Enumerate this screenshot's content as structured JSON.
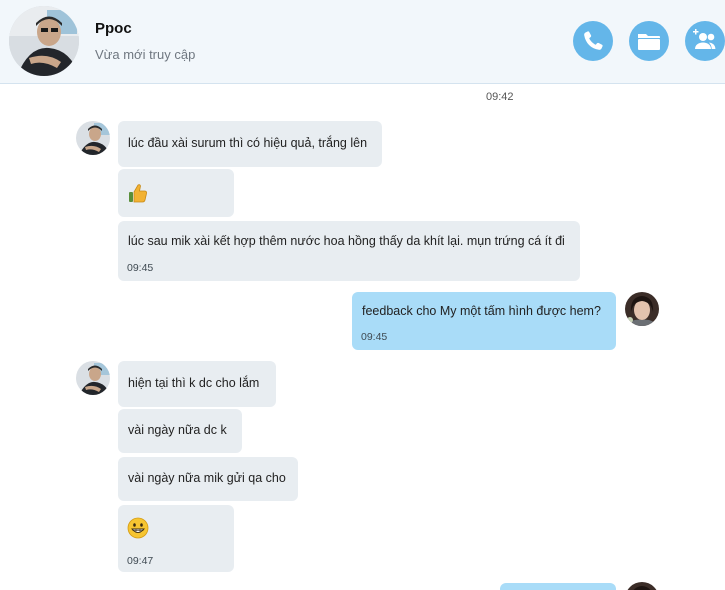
{
  "header": {
    "name": "Ppoc",
    "status": "Vừa mới truy cập",
    "icons": {
      "call": "phone-icon",
      "files": "folder-icon",
      "add": "add-user-icon"
    },
    "accent": "#64b6e9"
  },
  "chat": {
    "time_center": "09:42",
    "messages": [
      {
        "id": "m1",
        "dir": "in",
        "text": "lúc đầu xài surum thì có hiệu quả, trắng lên"
      },
      {
        "id": "m2",
        "dir": "in",
        "emoji": "thumbs-up-icon"
      },
      {
        "id": "m3",
        "dir": "in",
        "text": "lúc sau mik xài kết hợp thêm nước hoa hồng thấy da khít lại. mụn trứng cá ít đi",
        "time": "09:45"
      },
      {
        "id": "m4",
        "dir": "out",
        "text": "feedback cho My một tấm hình được hem?",
        "time": "09:45"
      },
      {
        "id": "m5",
        "dir": "in",
        "text": "hiện tại thì k dc cho lắm"
      },
      {
        "id": "m6",
        "dir": "in",
        "text": "vài ngày nữa dc k"
      },
      {
        "id": "m7",
        "dir": "in",
        "text": "vài ngày nữa mik gửi qa cho"
      },
      {
        "id": "m8",
        "dir": "in",
        "emoji": "grin-icon",
        "time": "09:47"
      }
    ]
  },
  "colors": {
    "incoming_bubble": "#e8edf1",
    "outgoing_bubble": "#a9dcf8",
    "header_bg": "#f2f7fb"
  }
}
